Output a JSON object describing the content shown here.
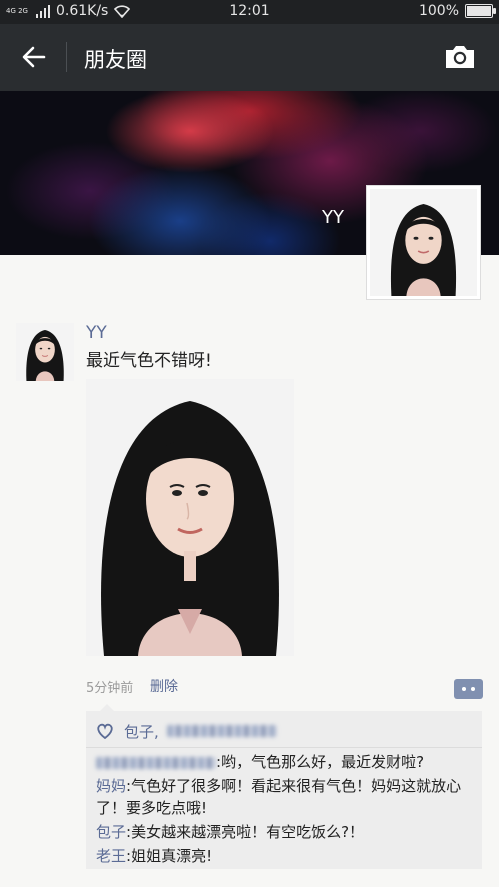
{
  "status_bar": {
    "network": "4G 2G",
    "speed": "0.61K/s",
    "time": "12:01",
    "battery": "100%"
  },
  "header": {
    "title": "朋友圈",
    "back_icon": "back-arrow-icon",
    "camera_icon": "camera-icon"
  },
  "profile": {
    "name": "YY"
  },
  "post": {
    "author": "YY",
    "text": "最近气色不错呀!",
    "time": "5分钟前",
    "delete_label": "删除"
  },
  "likes": {
    "first_name": "包子,"
  },
  "comments": [
    {
      "author": "",
      "sep": ":",
      "text": "哟，气色那么好，最近发财啦?"
    },
    {
      "author": "妈妈",
      "sep": ":",
      "text": "气色好了很多啊！看起来很有气色！妈妈这就放心了！要多吃点哦!"
    },
    {
      "author": "包子",
      "sep": ":",
      "text": "美女越来越漂亮啦！有空吃饭么?！"
    },
    {
      "author": "老王",
      "sep": ":",
      "text": "姐姐真漂亮!"
    }
  ],
  "colors": {
    "link": "#5b6b95",
    "titlebar": "#2a2d30",
    "statusbar": "#1f2123"
  }
}
